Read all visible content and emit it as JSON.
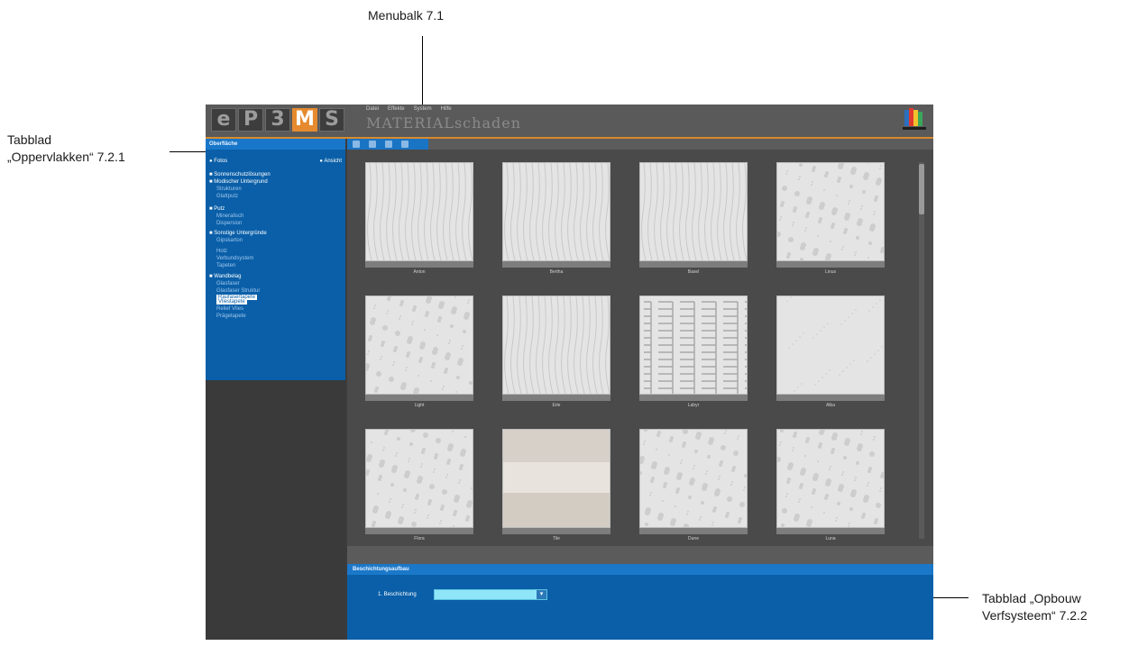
{
  "callouts": {
    "menubar": "Menubalk 7.1",
    "surfaces_line1": "Tabblad",
    "surfaces_line2": "„Oppervlakken“ 7.2.1",
    "build_line1": "Tabblad „Opbouw",
    "build_line2": "Verfsysteem“ 7.2.2"
  },
  "app": {
    "logo_letters": [
      "e",
      "P",
      "3",
      "M",
      "S"
    ],
    "logo_accent_color": "#e58a2e",
    "menu": [
      "Datei",
      "Effekte",
      "System",
      "Hilfe"
    ],
    "title": "MATERIALschaden",
    "brand_icon": "caparol-logo-icon"
  },
  "sidebar": {
    "tab_label": "Oberfläche",
    "head_left": "Fotos",
    "head_right": "Ansicht",
    "items": [
      {
        "label": "Sonnenschutzlösungen",
        "kind": "group"
      },
      {
        "label": "Modischer Untergrund",
        "kind": "group"
      },
      {
        "label": "Strukturen",
        "kind": "sub"
      },
      {
        "label": "Glattputz",
        "kind": "sub"
      },
      {
        "label": "Putz",
        "kind": "group"
      },
      {
        "label": "Mineralisch",
        "kind": "sub"
      },
      {
        "label": "Dispersion",
        "kind": "sub"
      },
      {
        "label": "Sonstige Untergründe",
        "kind": "group"
      },
      {
        "label": "Gipskarton",
        "kind": "sub"
      },
      {
        "label": "Holz",
        "kind": "sub"
      },
      {
        "label": "Verbundsystem",
        "kind": "sub"
      },
      {
        "label": "Tapeten",
        "kind": "sub"
      },
      {
        "label": "Wandbelag",
        "kind": "group"
      },
      {
        "label": "Glasfaser",
        "kind": "sub"
      },
      {
        "label": "Glasfaser Struktur",
        "kind": "sub"
      },
      {
        "label": "Raufasertapete",
        "kind": "highlight"
      },
      {
        "label": "Vliestapete",
        "kind": "highlight"
      },
      {
        "label": "Relief Vlies",
        "kind": "sub"
      },
      {
        "label": "Prägetapete",
        "kind": "sub"
      }
    ]
  },
  "grid": {
    "tiles": [
      {
        "label": "Anton",
        "pattern": "wood"
      },
      {
        "label": "Bertha",
        "pattern": "wood"
      },
      {
        "label": "Basel",
        "pattern": "wood"
      },
      {
        "label": "Linus",
        "pattern": "stone"
      },
      {
        "label": "Light",
        "pattern": "stone"
      },
      {
        "label": "Erle",
        "pattern": "wood"
      },
      {
        "label": "Labyr",
        "pattern": "maze"
      },
      {
        "label": "Alba",
        "pattern": "plain"
      },
      {
        "label": "Flora",
        "pattern": "stone"
      },
      {
        "label": "Tile",
        "pattern": "bands"
      },
      {
        "label": "Dune",
        "pattern": "stone"
      },
      {
        "label": "Luna",
        "pattern": "stone"
      }
    ]
  },
  "bottom_panel": {
    "tab_label": "Beschichtungsaufbau",
    "layer_label": "1. Beschichtung",
    "layer_value": ""
  }
}
